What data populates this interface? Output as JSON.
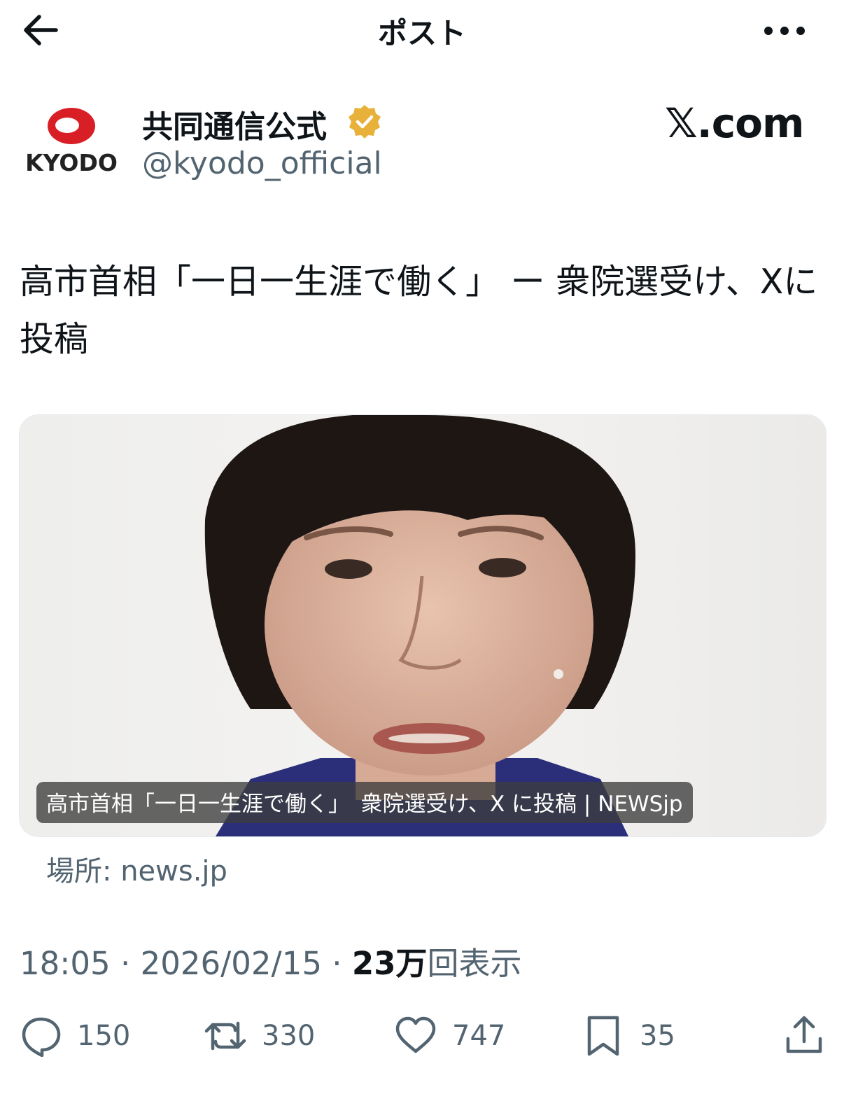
{
  "header": {
    "title": "ポスト"
  },
  "author": {
    "logo_text": "KYODO",
    "display_name": "共同通信公式",
    "handle": "@kyodo_official",
    "site": "𝕏.com"
  },
  "post": {
    "text": "高市首相「一日一生涯で働く」 ー 衆院選受け、Xに投稿"
  },
  "card": {
    "caption": "高市首相「一日一生涯で働く」　衆院選受け、X に投稿 | NEWSjp",
    "source": "場所: news.jp"
  },
  "meta": {
    "time": "18:05",
    "sep1": " · ",
    "date": "2026/02/15",
    "sep2": " · ",
    "views_count": "23万",
    "views_label": "回表示"
  },
  "actions": {
    "replies": "150",
    "reposts": "330",
    "likes": "747",
    "bookmarks": "35"
  },
  "icons": [
    "back-arrow-icon",
    "more-icon",
    "verified-icon",
    "reply-icon",
    "repost-icon",
    "like-icon",
    "bookmark-icon",
    "share-icon"
  ],
  "colors": {
    "text": "#0f1419",
    "secondary": "#536471",
    "verified": "#e8b23a",
    "kyodo_red": "#d91f26"
  }
}
